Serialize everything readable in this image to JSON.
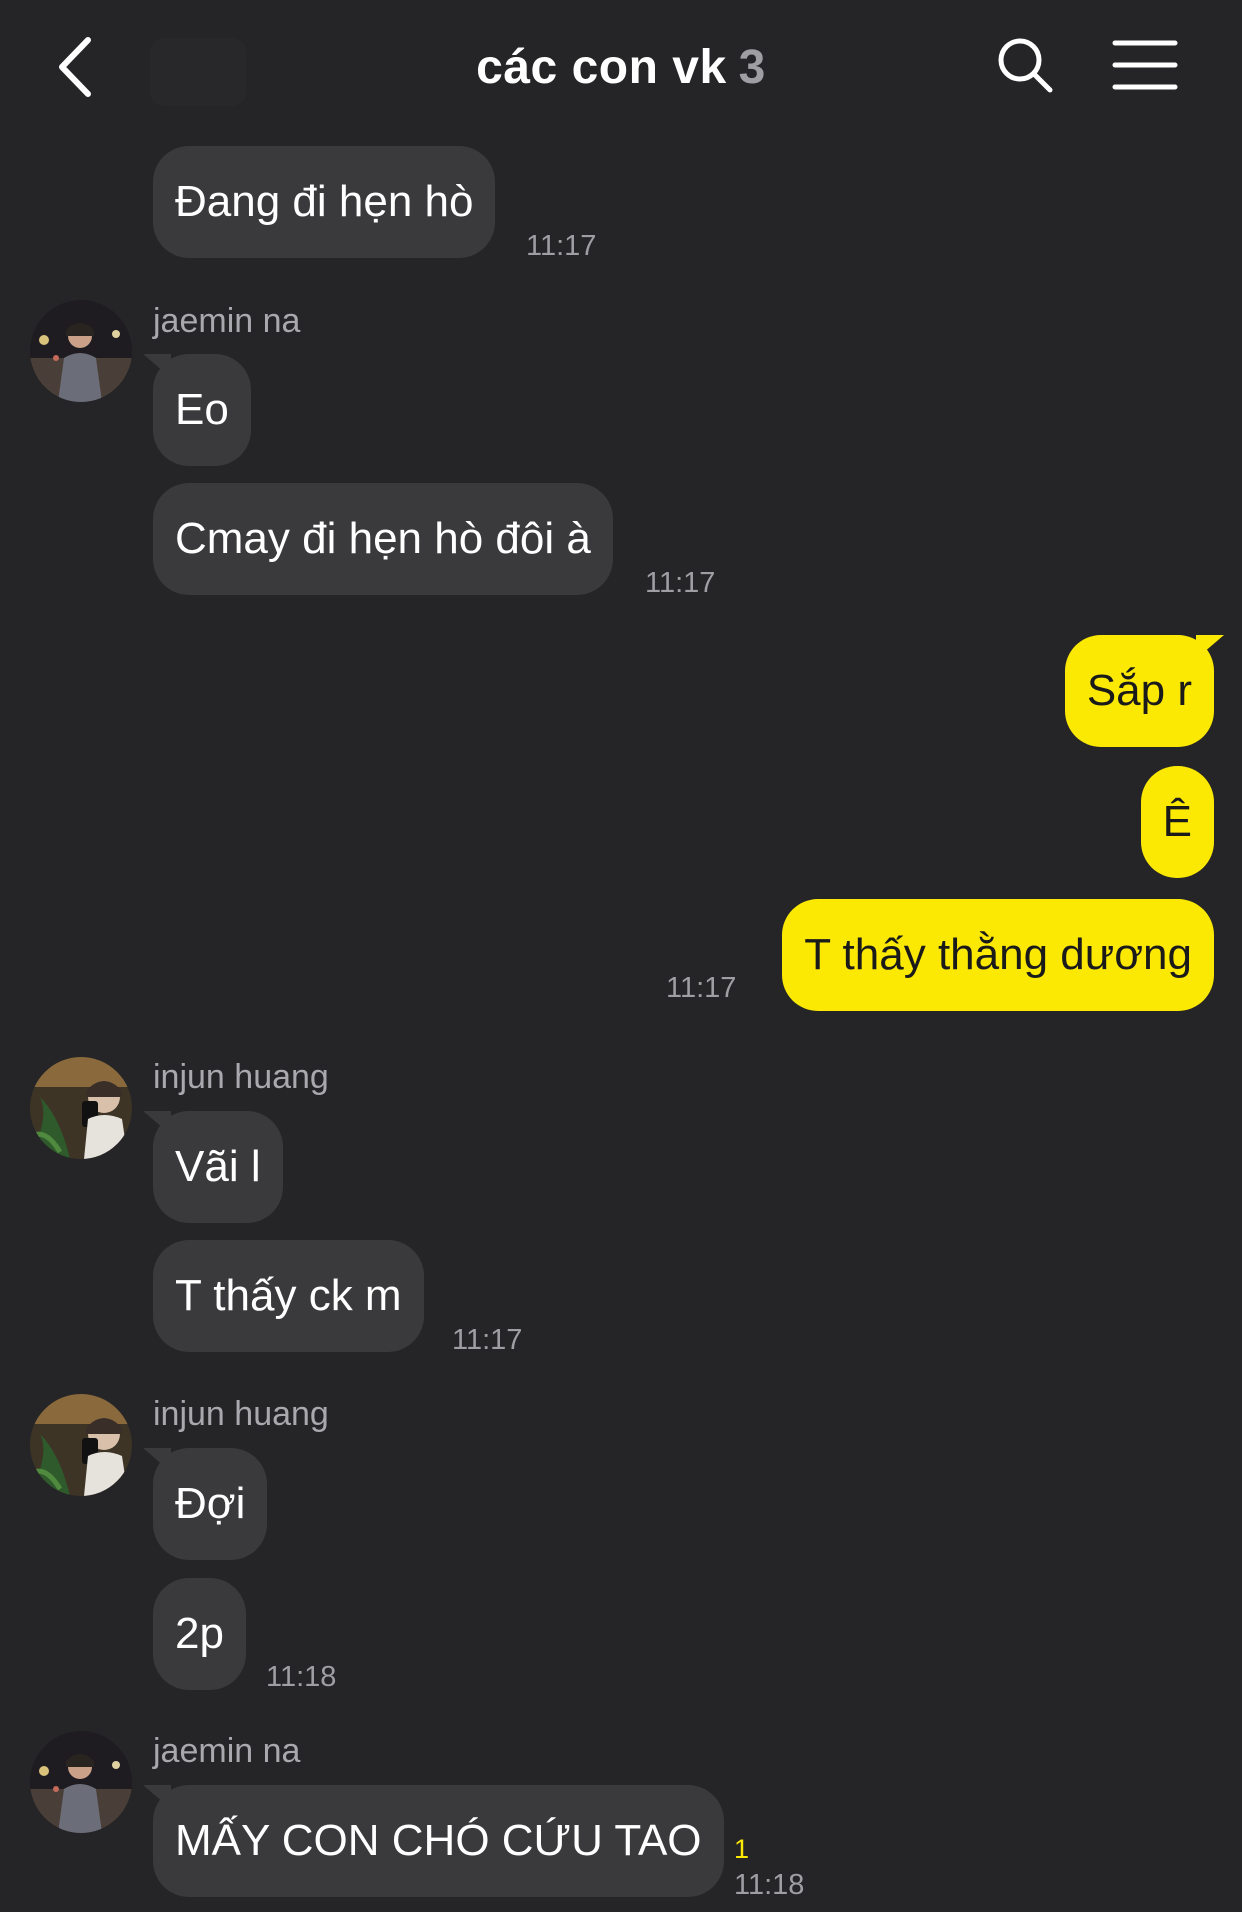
{
  "header": {
    "title": "các con vk",
    "member_count": "3",
    "icons": {
      "back": "chevron-left-icon",
      "search": "search-icon",
      "menu": "menu-icon"
    }
  },
  "colors": {
    "background": "#252527",
    "incoming_bubble": "#3a3a3c",
    "outgoing_bubble": "#fce903",
    "timestamp": "#9e9ea3"
  },
  "messages": {
    "m1": {
      "text": "Đang đi hẹn hò",
      "time": "11:17"
    },
    "g2": {
      "sender": "jaemin na",
      "m1": "Eo",
      "m2": "Cmay đi hẹn hò đôi à",
      "time": "11:17"
    },
    "mine": {
      "m1": "Sắp r",
      "m2": "Ê",
      "m3": "T thấy thằng dương",
      "time": "11:17"
    },
    "g3": {
      "sender": "injun huang",
      "m1": "Vãi l",
      "m2": "T thấy ck m",
      "time": "11:17"
    },
    "g4": {
      "sender": "injun huang",
      "m1": "Đợi",
      "m2": "2p",
      "time": "11:18"
    },
    "g5": {
      "sender": "jaemin na",
      "m1": "MẤY CON CHÓ CỨU TAO",
      "time": "11:18",
      "unread": "1"
    }
  }
}
